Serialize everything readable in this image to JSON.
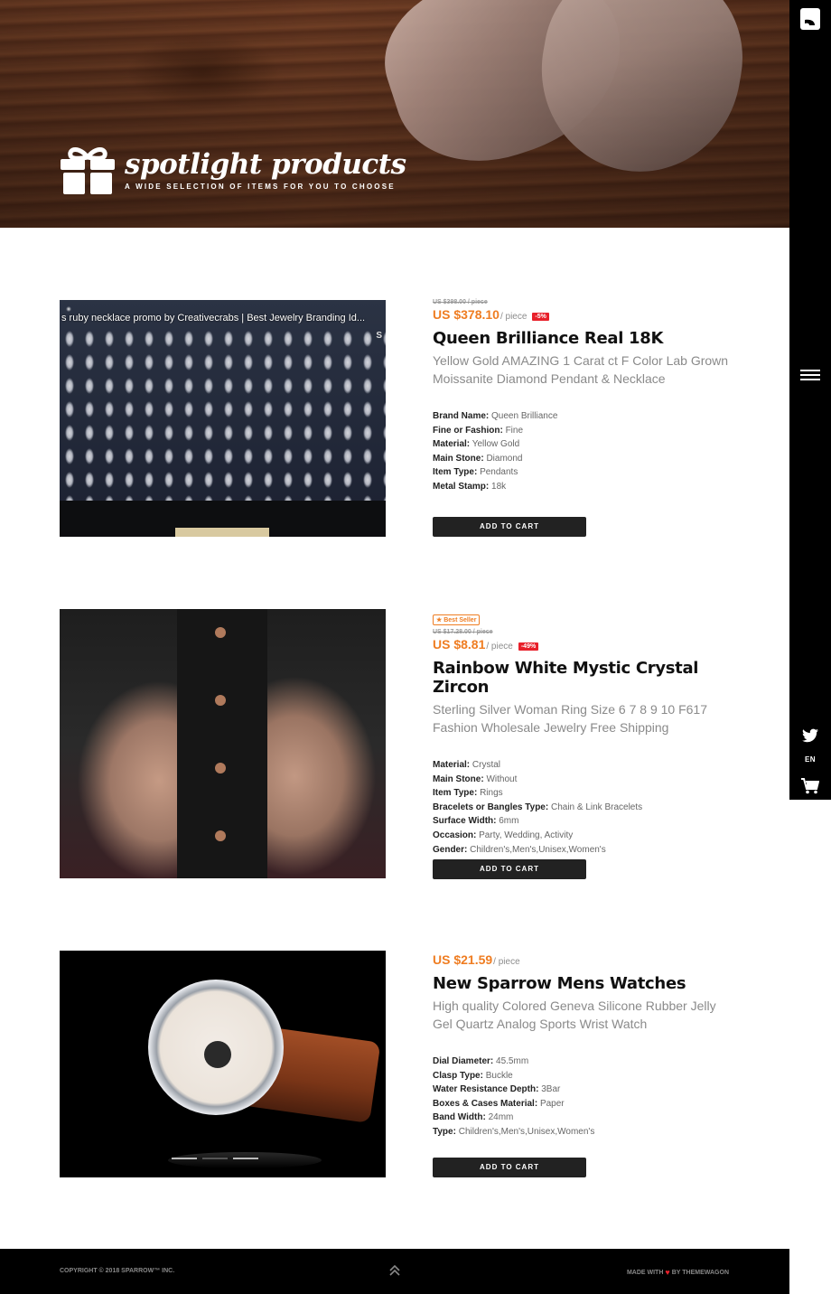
{
  "hero": {
    "title": "spotlight products",
    "subtitle": "A WIDE SELECTION OF ITEMS FOR YOU TO CHOOSE"
  },
  "sidebar": {
    "language": "EN"
  },
  "products": [
    {
      "image_caption": "s ruby necklace promo by Creativecrabs | Best Jewelry Branding Id...",
      "image_label": "S",
      "old_price": "US $398.00 / piece",
      "price": "US $378.10",
      "per": "/ piece",
      "discount": "-5%",
      "name": "Queen Brilliance Real 18K",
      "description": "Yellow Gold AMAZING 1 Carat ct F Color Lab Grown Moissanite Diamond Pendant & Necklace",
      "specs": [
        {
          "label": "Brand Name:",
          "value": "Queen Brilliance"
        },
        {
          "label": "Fine or Fashion:",
          "value": "Fine"
        },
        {
          "label": "Material:",
          "value": "Yellow Gold"
        },
        {
          "label": "Main Stone:",
          "value": "Diamond"
        },
        {
          "label": "Item Type:",
          "value": "Pendants"
        },
        {
          "label": "Metal Stamp:",
          "value": "18k"
        }
      ],
      "cart_label": "ADD TO CART"
    },
    {
      "badge": "Best Seller",
      "old_price": "US $17.28.00 / piece",
      "price": "US $8.81",
      "per": "/ piece",
      "discount": "-49%",
      "name": "Rainbow White Mystic Crystal Zircon",
      "description": "Sterling Silver Woman Ring Size 6 7 8 9 10 F617 Fashion Wholesale Jewelry Free Shipping",
      "specs": [
        {
          "label": "Material:",
          "value": "Crystal"
        },
        {
          "label": "Main Stone:",
          "value": "Without"
        },
        {
          "label": "Item Type:",
          "value": "Rings"
        },
        {
          "label": "Bracelets or Bangles Type:",
          "value": "Chain & Link Bracelets"
        },
        {
          "label": "Surface Width:",
          "value": "6mm"
        },
        {
          "label": "Occasion:",
          "value": "Party, Wedding, Activity"
        },
        {
          "label": "Gender:",
          "value": "Children's,Men's,Unisex,Women's"
        }
      ],
      "cart_label": "ADD TO CART"
    },
    {
      "price": "US $21.59",
      "per": "/ piece",
      "name": "New Sparrow Mens Watches",
      "description": "High quality Colored Geneva Silicone Rubber Jelly Gel Quartz Analog Sports Wrist Watch",
      "specs": [
        {
          "label": "Dial Diameter:",
          "value": "45.5mm"
        },
        {
          "label": "Clasp Type:",
          "value": "Buckle"
        },
        {
          "label": "Water Resistance Depth:",
          "value": "3Bar"
        },
        {
          "label": "Boxes & Cases Material:",
          "value": "Paper"
        },
        {
          "label": "Band Width:",
          "value": "24mm"
        },
        {
          "label": "Type:",
          "value": "Children's,Men's,Unisex,Women's"
        }
      ],
      "cart_label": "ADD TO CART"
    }
  ],
  "footer": {
    "copyright": "COPYRIGHT © 2018 SPARROW™ INC.",
    "made_with": "MADE WITH",
    "by": "BY THEMEWAGON"
  },
  "colors": {
    "accent": "#ef7d22",
    "discount": "#e8202a",
    "dark": "#000000"
  }
}
